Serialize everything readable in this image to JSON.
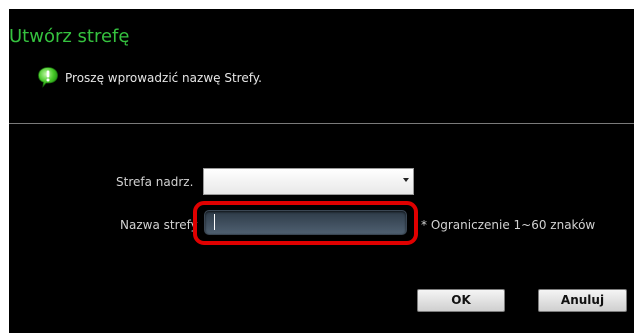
{
  "dialog": {
    "title": "Utwórz strefę",
    "info_icon": "info-bubble-icon",
    "info_text": "Proszę wprowadzić nazwę Strefy."
  },
  "form": {
    "parent_zone": {
      "label": "Strefa nadrz.",
      "value": ""
    },
    "zone_name": {
      "label": "Nazwa strefy",
      "value": "",
      "hint": "* Ograniczenie 1~60 znaków"
    }
  },
  "buttons": {
    "ok": "OK",
    "cancel": "Anuluj"
  },
  "colors": {
    "title": "#35c23f",
    "background": "#000000",
    "highlight": "#e00000"
  }
}
